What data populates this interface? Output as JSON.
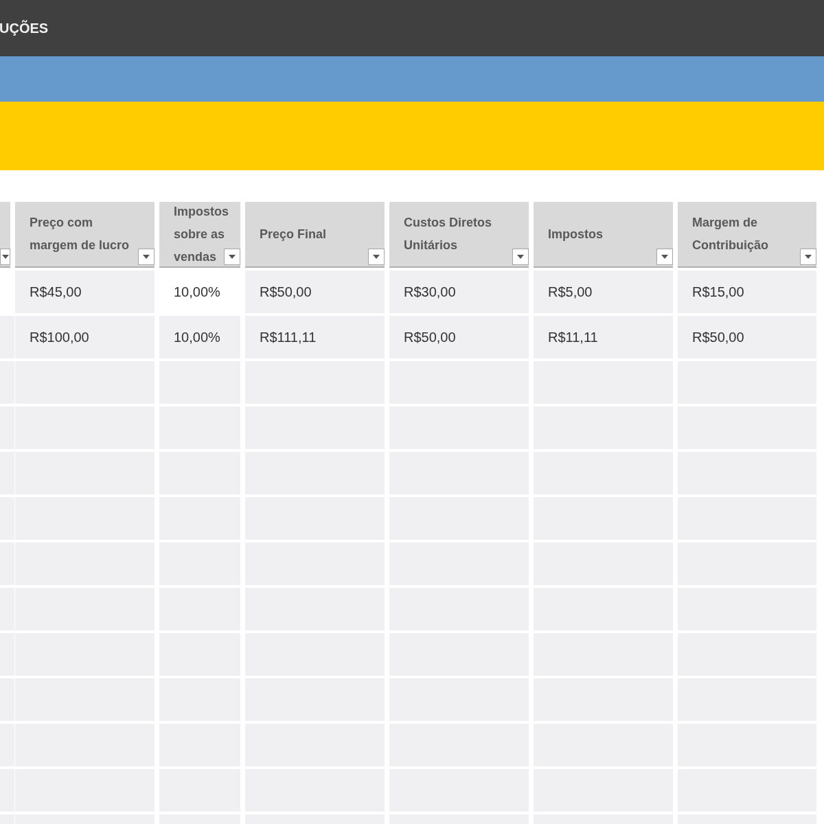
{
  "title_bar": {
    "title": "UÇÕES"
  },
  "table": {
    "columns": [
      {
        "filter": true
      },
      {
        "label": "Preço com margem de lucro",
        "filter": true
      },
      {
        "label": "Impostos sobre as vendas",
        "filter": true
      },
      {
        "label": "Preço Final",
        "filter": true
      },
      {
        "label": "Custos Diretos Unitários",
        "filter": true
      },
      {
        "label": "Impostos",
        "filter": true
      },
      {
        "label": "Margem de Contribuição",
        "filter": true
      }
    ],
    "rows": [
      {
        "cells": [
          {
            "editable": true
          },
          {
            "text": "R$45,00",
            "editable": false
          },
          {
            "text": "10,00%",
            "editable": true
          },
          {
            "text": "R$50,00",
            "editable": false
          },
          {
            "text": "R$30,00",
            "editable": false
          },
          {
            "text": "R$5,00",
            "editable": false
          },
          {
            "text": "R$15,00",
            "editable": false
          }
        ]
      },
      {
        "cells": [
          {
            "editable": false
          },
          {
            "text": "R$100,00",
            "editable": false
          },
          {
            "text": "10,00%",
            "editable": false
          },
          {
            "text": "R$111,11",
            "editable": false
          },
          {
            "text": "R$50,00",
            "editable": false
          },
          {
            "text": "R$11,11",
            "editable": false
          },
          {
            "text": "R$50,00",
            "editable": false
          }
        ]
      }
    ]
  }
}
